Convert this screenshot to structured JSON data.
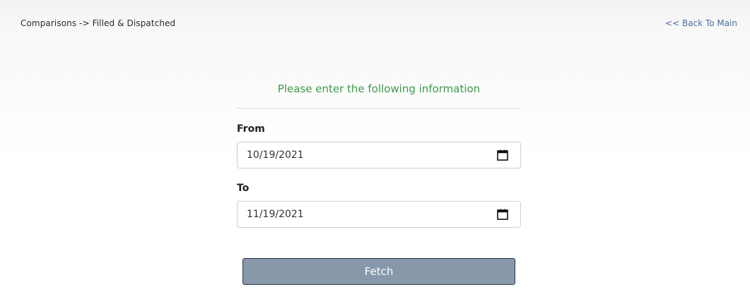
{
  "breadcrumb": "Comparisons -> Filled & Dispatched",
  "back_link": "<< Back To Main",
  "form": {
    "heading": "Please enter the following information",
    "from": {
      "label": "From",
      "value": "10/19/2021"
    },
    "to": {
      "label": "To",
      "value": "11/19/2021"
    },
    "submit_label": "Fetch"
  },
  "icons": {
    "calendar": "calendar-icon"
  },
  "colors": {
    "heading": "#3f9a4a",
    "link": "#4a6fa5",
    "button_bg": "#8798ab",
    "button_border": "#2f3a48"
  }
}
